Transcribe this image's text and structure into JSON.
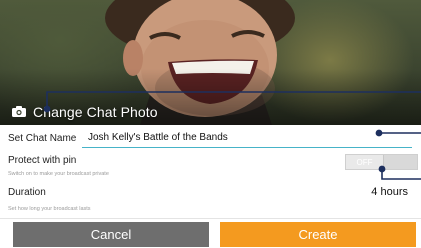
{
  "header": {
    "change_photo_label": "Change Chat Photo",
    "camera_icon": "camera-icon"
  },
  "form": {
    "name_label": "Set Chat Name",
    "name_value": "Josh Kelly's Battle of the Bands",
    "pin_title": "Protect with pin",
    "pin_hint": "Switch on to make your broadcast private",
    "pin_toggle_state": "OFF",
    "duration_title": "Duration",
    "duration_hint": "Set how long your broadcast lasts",
    "duration_value": "4 hours"
  },
  "actions": {
    "cancel_label": "Cancel",
    "create_label": "Create"
  },
  "colors": {
    "accent_teal": "#46b3c8",
    "create_orange": "#f49a1f",
    "cancel_gray": "#6e6e6e",
    "callout_navy": "#1d2f5e"
  }
}
